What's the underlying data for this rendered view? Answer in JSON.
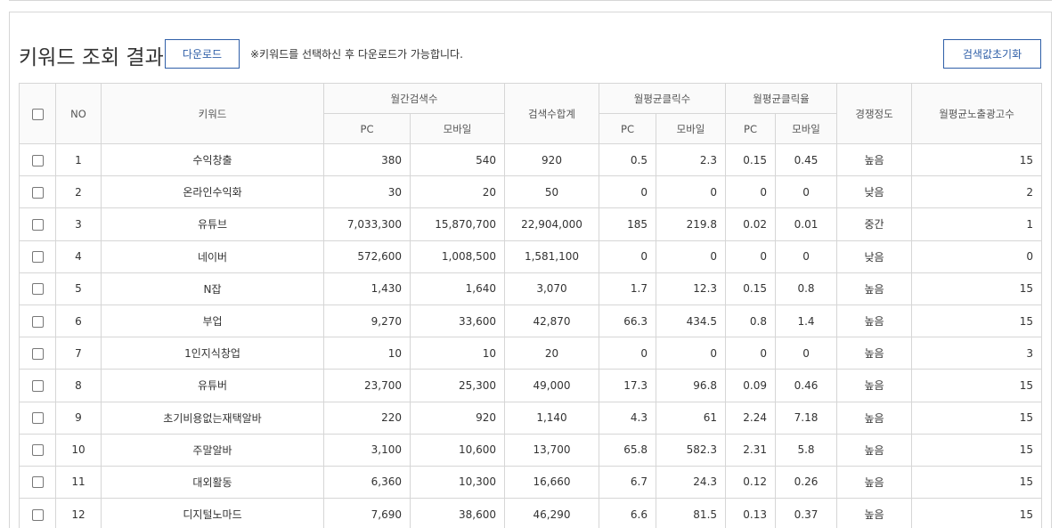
{
  "title": "키워드 조회 결과",
  "download_label": "다운로드",
  "notice": "※키워드를 선택하신 후 다운로드가 가능합니다.",
  "reset_label": "검색값초기화",
  "headers": {
    "no": "NO",
    "keyword": "키워드",
    "monthly_search": "월간검색수",
    "search_total": "검색수합계",
    "avg_clicks": "월평균클릭수",
    "avg_ctr": "월평균클릭율",
    "competition": "경쟁정도",
    "avg_ad_count": "월평균노출광고수",
    "pc": "PC",
    "mobile": "모바일"
  },
  "rows": [
    {
      "no": "1",
      "keyword": "수익창출",
      "search_pc": "380",
      "search_mobile": "540",
      "total": "920",
      "click_pc": "0.5",
      "click_mobile": "2.3",
      "ctr_pc": "0.15",
      "ctr_mobile": "0.45",
      "competition": "높음",
      "ads": "15"
    },
    {
      "no": "2",
      "keyword": "온라인수익화",
      "search_pc": "30",
      "search_mobile": "20",
      "total": "50",
      "click_pc": "0",
      "click_mobile": "0",
      "ctr_pc": "0",
      "ctr_mobile": "0",
      "competition": "낮음",
      "ads": "2"
    },
    {
      "no": "3",
      "keyword": "유튜브",
      "search_pc": "7,033,300",
      "search_mobile": "15,870,700",
      "total": "22,904,000",
      "click_pc": "185",
      "click_mobile": "219.8",
      "ctr_pc": "0.02",
      "ctr_mobile": "0.01",
      "competition": "중간",
      "ads": "1"
    },
    {
      "no": "4",
      "keyword": "네이버",
      "search_pc": "572,600",
      "search_mobile": "1,008,500",
      "total": "1,581,100",
      "click_pc": "0",
      "click_mobile": "0",
      "ctr_pc": "0",
      "ctr_mobile": "0",
      "competition": "낮음",
      "ads": "0"
    },
    {
      "no": "5",
      "keyword": "N잡",
      "search_pc": "1,430",
      "search_mobile": "1,640",
      "total": "3,070",
      "click_pc": "1.7",
      "click_mobile": "12.3",
      "ctr_pc": "0.15",
      "ctr_mobile": "0.8",
      "competition": "높음",
      "ads": "15"
    },
    {
      "no": "6",
      "keyword": "부업",
      "search_pc": "9,270",
      "search_mobile": "33,600",
      "total": "42,870",
      "click_pc": "66.3",
      "click_mobile": "434.5",
      "ctr_pc": "0.8",
      "ctr_mobile": "1.4",
      "competition": "높음",
      "ads": "15"
    },
    {
      "no": "7",
      "keyword": "1인지식창업",
      "search_pc": "10",
      "search_mobile": "10",
      "total": "20",
      "click_pc": "0",
      "click_mobile": "0",
      "ctr_pc": "0",
      "ctr_mobile": "0",
      "competition": "높음",
      "ads": "3"
    },
    {
      "no": "8",
      "keyword": "유튜버",
      "search_pc": "23,700",
      "search_mobile": "25,300",
      "total": "49,000",
      "click_pc": "17.3",
      "click_mobile": "96.8",
      "ctr_pc": "0.09",
      "ctr_mobile": "0.46",
      "competition": "높음",
      "ads": "15"
    },
    {
      "no": "9",
      "keyword": "초기비용없는재택알바",
      "search_pc": "220",
      "search_mobile": "920",
      "total": "1,140",
      "click_pc": "4.3",
      "click_mobile": "61",
      "ctr_pc": "2.24",
      "ctr_mobile": "7.18",
      "competition": "높음",
      "ads": "15"
    },
    {
      "no": "10",
      "keyword": "주말알바",
      "search_pc": "3,100",
      "search_mobile": "10,600",
      "total": "13,700",
      "click_pc": "65.8",
      "click_mobile": "582.3",
      "ctr_pc": "2.31",
      "ctr_mobile": "5.8",
      "competition": "높음",
      "ads": "15"
    },
    {
      "no": "11",
      "keyword": "대외활동",
      "search_pc": "6,360",
      "search_mobile": "10,300",
      "total": "16,660",
      "click_pc": "6.7",
      "click_mobile": "24.3",
      "ctr_pc": "0.12",
      "ctr_mobile": "0.26",
      "competition": "높음",
      "ads": "15"
    },
    {
      "no": "12",
      "keyword": "디지털노마드",
      "search_pc": "7,690",
      "search_mobile": "38,600",
      "total": "46,290",
      "click_pc": "6.6",
      "click_mobile": "81.5",
      "ctr_pc": "0.13",
      "ctr_mobile": "0.37",
      "competition": "높음",
      "ads": "15"
    }
  ]
}
